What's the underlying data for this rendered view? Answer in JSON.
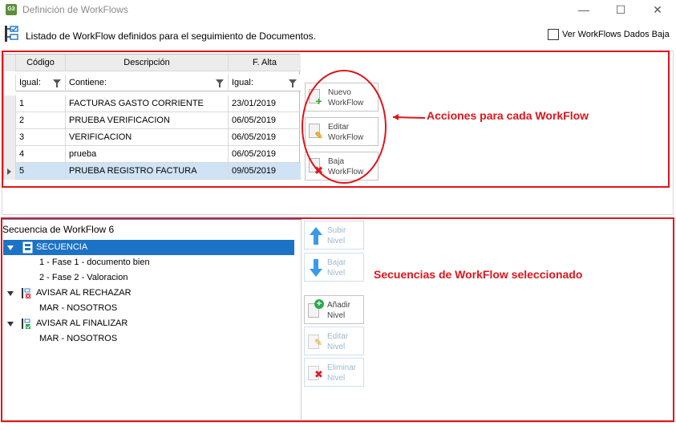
{
  "window": {
    "title": "Definición de WorkFlows",
    "app_icon_text": "G3",
    "minimize_glyph": "—",
    "maximize_glyph": "☐",
    "close_glyph": "✕"
  },
  "header": {
    "title": "Listado de WorkFlow definidos para el seguimiento de Documentos.",
    "show_deleted_label": "Ver WorkFlows Dados Baja",
    "show_deleted_checked": false
  },
  "grid": {
    "columns": [
      "Código",
      "Descripción",
      "F. Alta"
    ],
    "filters": [
      "Igual:",
      "Contiene:",
      "Igual:"
    ],
    "rows": [
      {
        "code": "1",
        "description": "FACTURAS GASTO CORRIENTE",
        "date": "23/01/2019"
      },
      {
        "code": "2",
        "description": "PRUEBA VERIFICACION",
        "date": "06/05/2019"
      },
      {
        "code": "3",
        "description": "VERIFICACION",
        "date": "06/05/2019"
      },
      {
        "code": "4",
        "description": "prueba",
        "date": "06/05/2019"
      },
      {
        "code": "5",
        "description": "PRUEBA REGISTRO FACTURA",
        "date": "09/05/2019"
      }
    ],
    "selected_row": 4
  },
  "actions": {
    "new": {
      "line1": "Nuevo",
      "line2": "WorkFlow"
    },
    "edit": {
      "line1": "Editar",
      "line2": "WorkFlow"
    },
    "delete": {
      "line1": "Baja",
      "line2": "WorkFlow"
    }
  },
  "sequence": {
    "title": "Secuencia de WorkFlow 6",
    "nodes": [
      {
        "label": "SECUENCIA",
        "children": [
          "1 - Fase 1 - documento bien",
          "2 - Fase 2 - Valoracion"
        ]
      },
      {
        "label": "AVISAR AL RECHAZAR",
        "children": [
          "MAR - NOSOTROS"
        ]
      },
      {
        "label": "AVISAR AL FINALIZAR",
        "children": [
          "MAR - NOSOTROS"
        ]
      }
    ],
    "buttons": {
      "up": {
        "line1": "Subir",
        "line2": "Nivel",
        "enabled": false
      },
      "down": {
        "line1": "Bajar",
        "line2": "Nivel",
        "enabled": false
      },
      "add": {
        "line1": "Añadir",
        "line2": "Nivel",
        "enabled": true
      },
      "edit": {
        "line1": "Editar",
        "line2": "Nivel",
        "enabled": false
      },
      "delete": {
        "line1": "Eliminar",
        "line2": "Nivel",
        "enabled": false
      }
    }
  },
  "annotations": {
    "actions_note": "Acciones para cada WorkFlow",
    "sequence_note": "Secuencias de WorkFlow seleccionado"
  },
  "colors": {
    "annotation_red": "#e0141b",
    "selection_blue": "#1c73c5",
    "row_selected": "#cfe3f5"
  }
}
